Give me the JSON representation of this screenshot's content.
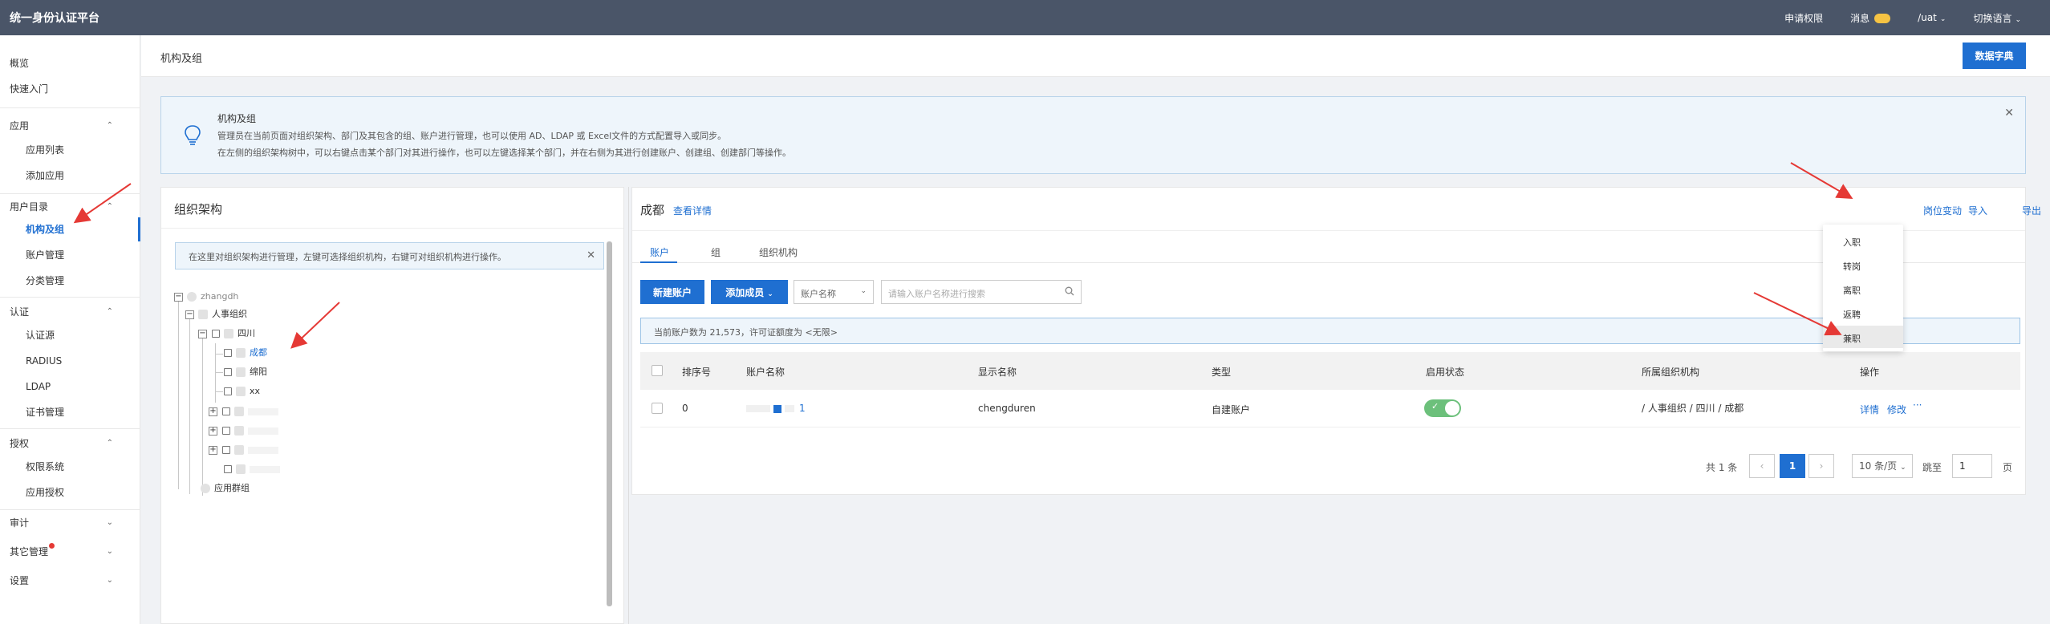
{
  "topbar": {
    "brand": "统一身份认证平台",
    "apply_permission": "申请权限",
    "messages": "消息",
    "user": "/uat",
    "switch_language": "切换语言"
  },
  "sidebar": {
    "items": [
      {
        "label": "概览"
      },
      {
        "label": "快速入门"
      },
      {
        "label": "应用"
      },
      {
        "label": "应用列表"
      },
      {
        "label": "添加应用"
      },
      {
        "label": "用户目录"
      },
      {
        "label": "机构及组"
      },
      {
        "label": "账户管理"
      },
      {
        "label": "分类管理"
      },
      {
        "label": "认证"
      },
      {
        "label": "认证源"
      },
      {
        "label": "RADIUS"
      },
      {
        "label": "LDAP"
      },
      {
        "label": "证书管理"
      },
      {
        "label": "授权"
      },
      {
        "label": "权限系统"
      },
      {
        "label": "应用授权"
      },
      {
        "label": "审计"
      },
      {
        "label": "其它管理"
      },
      {
        "label": "设置"
      }
    ]
  },
  "breadcrumb": {
    "title": "机构及组",
    "dict_button": "数据字典"
  },
  "notice": {
    "title": "机构及组",
    "line1": "管理员在当前页面对组织架构、部门及其包含的组、账户进行管理，也可以使用 AD、LDAP 或 Excel文件的方式配置导入或同步。",
    "line2": "在左侧的组织架构树中，可以右键点击某个部门对其进行操作，也可以左键选择某个部门，并在右侧为其进行创建账户、创建组、创建部门等操作。"
  },
  "org_panel": {
    "title": "组织架构",
    "tip": "在这里对组织架构进行管理，左键可选择组织机构，右键可对组织机构进行操作。",
    "tree": {
      "root": "zhangdh",
      "hr_org": "人事组织",
      "sichuan": "四川",
      "chengdu": "成都",
      "mianyang": "绵阳",
      "xx": "xx",
      "app_group": "应用群组"
    }
  },
  "detail_panel": {
    "title": "成都",
    "view_details": "查看详情",
    "menus": {
      "position_change": "岗位变动",
      "import": "导入",
      "export": "导出"
    },
    "tabs": [
      "账户",
      "组",
      "组织机构"
    ],
    "new_account": "新建账户",
    "add_member": "添加成员",
    "filter_select": "账户名称",
    "search_placeholder": "请输入账户名称进行搜索",
    "count_text": "当前账户数为 21,573，许可证额度为 <无限>",
    "columns": [
      "排序号",
      "账户名称",
      "显示名称",
      "类型",
      "启用状态",
      "所属组织机构",
      "操作"
    ],
    "rows": [
      {
        "order": "0",
        "account_suffix": "1",
        "display_name": "chengduren",
        "type": "自建账户",
        "enabled": true,
        "org": "/ 人事组织 / 四川 / 成都",
        "action_detail": "详情",
        "action_edit": "修改",
        "action_more": "···"
      }
    ],
    "pagination": {
      "total": "共 1 条",
      "current_page": "1",
      "page_size": "10 条/页",
      "jump_label": "跳至",
      "jump_value": "1",
      "page_suffix": "页"
    }
  },
  "dropdown": {
    "items": [
      "入职",
      "转岗",
      "离职",
      "返聘",
      "兼职"
    ]
  },
  "colors": {
    "primary": "#1f6fd1",
    "topbar": "#4a5568",
    "arrow": "#e53935"
  }
}
